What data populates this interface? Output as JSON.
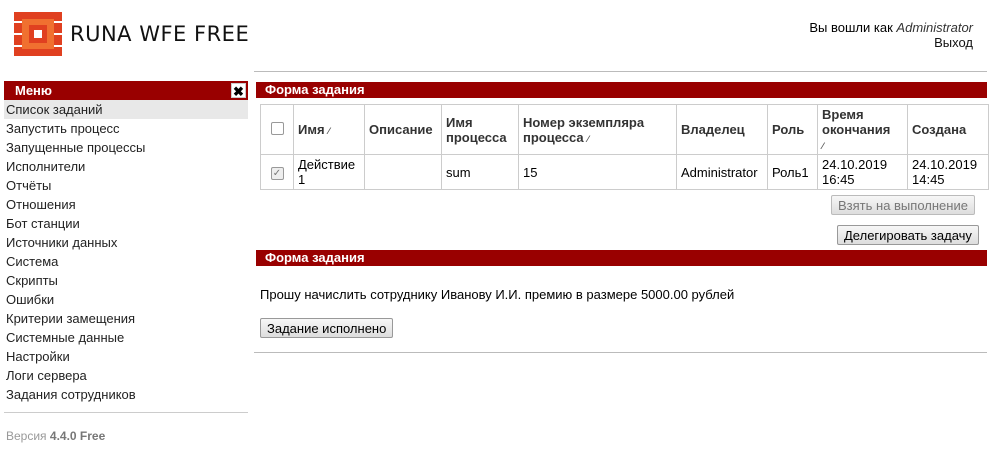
{
  "brand": {
    "name": "RUNA WFE FREE"
  },
  "user": {
    "prefix": "Вы вошли как",
    "name": "Administrator",
    "logout": "Выход"
  },
  "menu": {
    "title": "Меню",
    "close": "✖",
    "items": [
      "Список заданий",
      "Запустить процесс",
      "Запущенные процессы",
      "Исполнители",
      "Отчёты",
      "Отношения",
      "Бот станции",
      "Источники данных",
      "Система",
      "Скрипты",
      "Ошибки",
      "Критерии замещения",
      "Системные данные",
      "Настройки",
      "Логи сервера",
      "Задания сотрудников"
    ]
  },
  "version": {
    "label": "Версия",
    "value": "4.4.0 Free"
  },
  "task_form": {
    "title": "Форма задания",
    "columns": {
      "name": "Имя",
      "description": "Описание",
      "process_name": "Имя процесса",
      "instance": "Номер экземпляра процесса",
      "owner": "Владелец",
      "role": "Роль",
      "deadline": "Время окончания",
      "created": "Создана"
    },
    "row": {
      "name": "Действие 1",
      "description": "",
      "process_name": "sum",
      "instance": "15",
      "owner": "Administrator",
      "role": "Роль1",
      "deadline": "24.10.2019 16:45",
      "created": "24.10.2019 14:45"
    },
    "take_button": "Взять на выполнение",
    "delegate_button": "Делегировать задачу"
  },
  "detail_form": {
    "title": "Форма задания",
    "message": "Прошу начислить сотруднику Иванову И.И. премию в размере 5000.00 рублей",
    "complete_button": "Задание исполнено"
  }
}
